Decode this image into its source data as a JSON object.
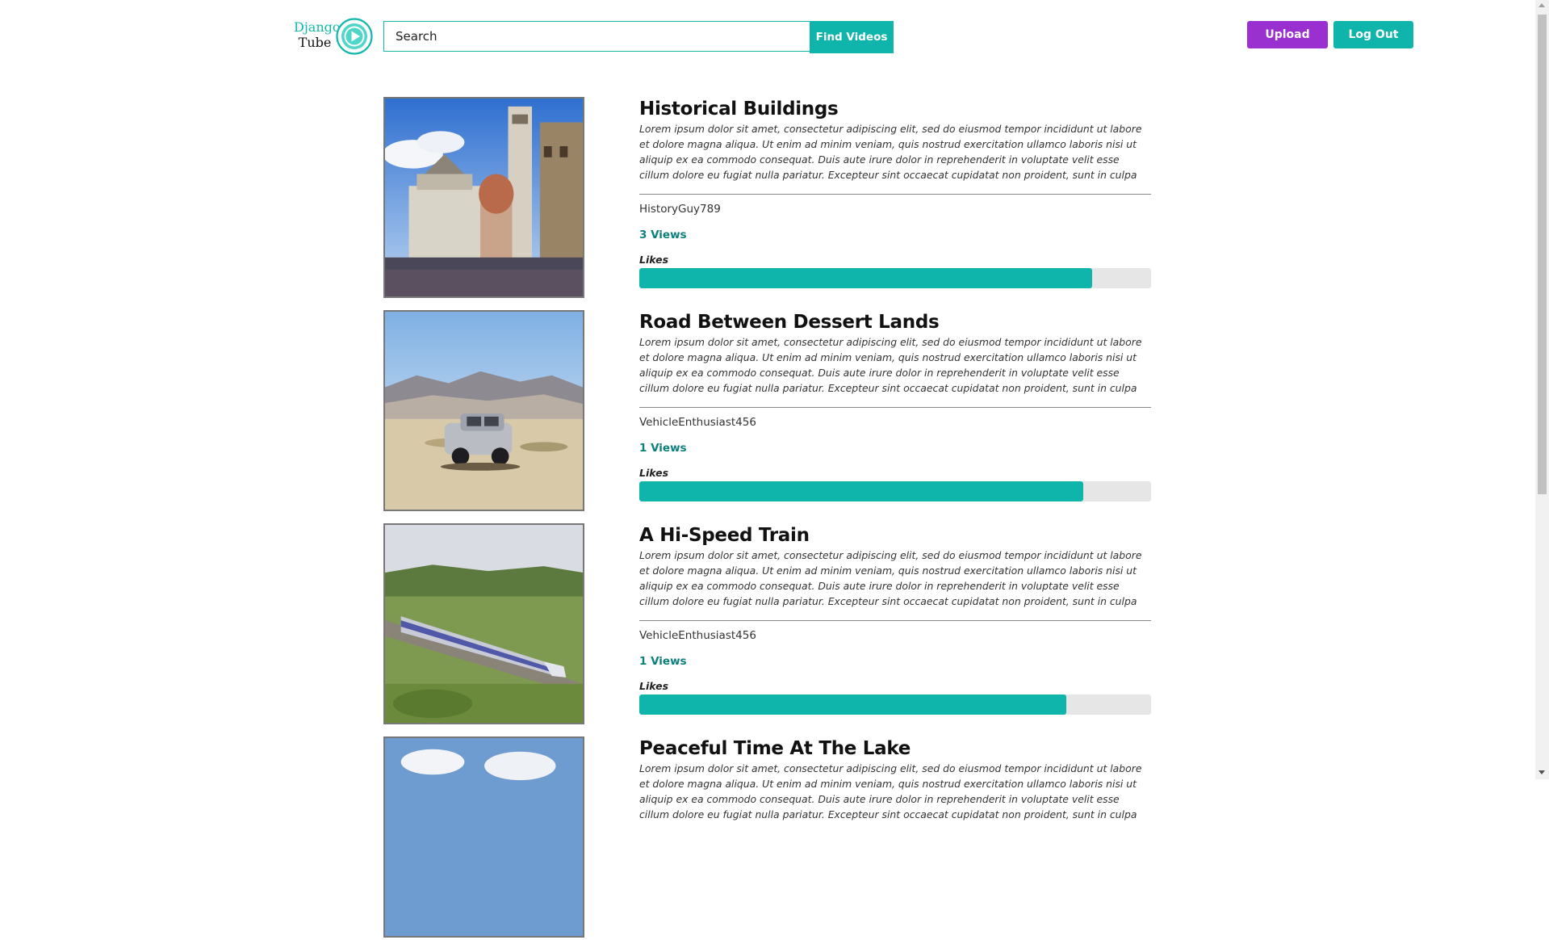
{
  "header": {
    "logo_line1": "Django",
    "logo_line2": "Tube",
    "search_placeholder": "Search",
    "find_button": "Find Videos",
    "upload_button": "Upload",
    "logout_button": "Log Out"
  },
  "colors": {
    "accent": "#0fb5aa",
    "upload": "#9b30d0",
    "views_text": "#0c7f7c"
  },
  "likes_label": "Likes",
  "videos": [
    {
      "title": "Historical Buildings",
      "description": "Lorem ipsum dolor sit amet, consectetur adipiscing elit, sed do eiusmod tempor incididunt ut labore et dolore magna aliqua. Ut enim ad minim veniam, quis nostrud exercitation ullamco laboris nisi ut aliquip ex ea commodo consequat. Duis aute irure dolor in reprehenderit in voluptate velit esse cillum dolore eu fugiat nulla pariatur. Excepteur sint occaecat cupidatat non proident, sunt in culpa qui officia deserunt mollit anim id est laborum",
      "author": "HistoryGuy789",
      "views": "3 Views",
      "likes_fraction": 0.885
    },
    {
      "title": "Road Between Dessert Lands",
      "description": "Lorem ipsum dolor sit amet, consectetur adipiscing elit, sed do eiusmod tempor incididunt ut labore et dolore magna aliqua. Ut enim ad minim veniam, quis nostrud exercitation ullamco laboris nisi ut aliquip ex ea commodo consequat. Duis aute irure dolor in reprehenderit in voluptate velit esse cillum dolore eu fugiat nulla pariatur. Excepteur sint occaecat cupidatat non proident, sunt in culpa qui officia deserunt mollit anim id est laborum",
      "author": "VehicleEnthusiast456",
      "views": "1 Views",
      "likes_fraction": 0.867
    },
    {
      "title": "A Hi-Speed Train",
      "description": "Lorem ipsum dolor sit amet, consectetur adipiscing elit, sed do eiusmod tempor incididunt ut labore et dolore magna aliqua. Ut enim ad minim veniam, quis nostrud exercitation ullamco laboris nisi ut aliquip ex ea commodo consequat. Duis aute irure dolor in reprehenderit in voluptate velit esse cillum dolore eu fugiat nulla pariatur. Excepteur sint occaecat cupidatat non proident, sunt in culpa qui officia deserunt mollit anim id est laborum",
      "author": "VehicleEnthusiast456",
      "views": "1 Views",
      "likes_fraction": 0.834
    },
    {
      "title": "Peaceful Time At The Lake",
      "description": "Lorem ipsum dolor sit amet, consectetur adipiscing elit, sed do eiusmod tempor incididunt ut labore et dolore magna aliqua. Ut enim ad minim veniam, quis nostrud exercitation ullamco laboris nisi ut aliquip ex ea commodo consequat. Duis aute irure dolor in reprehenderit in voluptate velit esse cillum dolore eu fugiat nulla pariatur. Excepteur sint occaecat cupidatat non proident, sunt in culpa qui officia deserunt mollit anim id est laborum"
    }
  ]
}
